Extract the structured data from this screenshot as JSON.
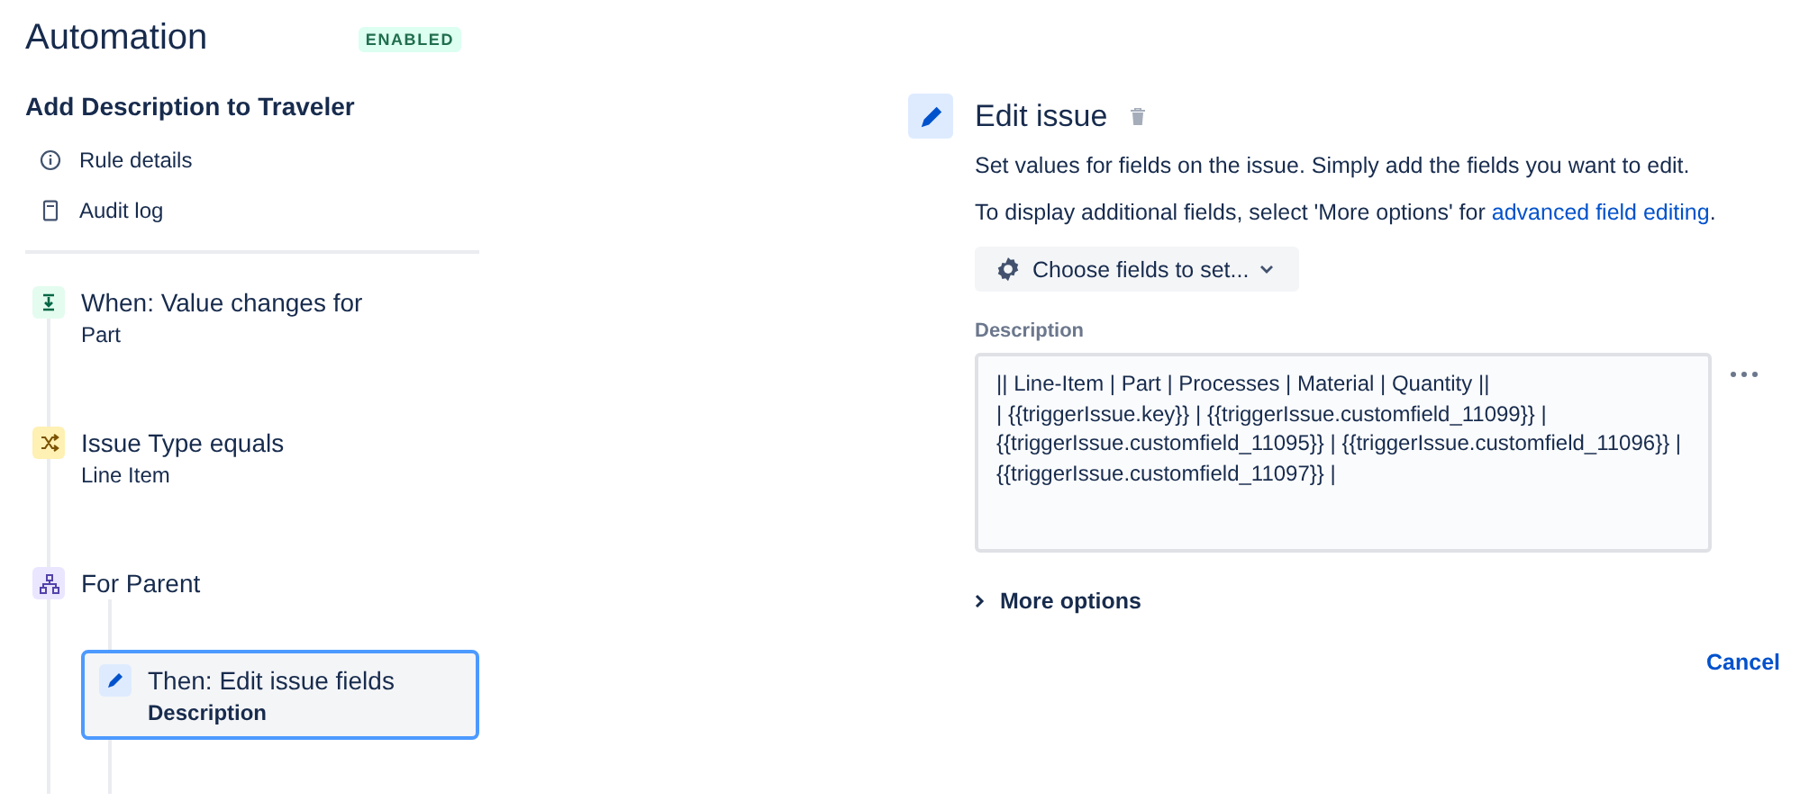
{
  "header": {
    "title": "Automation",
    "status": "ENABLED"
  },
  "rule": {
    "name": "Add Description to Traveler",
    "links": [
      {
        "kind": "info",
        "label": "Rule details"
      },
      {
        "kind": "log",
        "label": "Audit log"
      }
    ],
    "steps": [
      {
        "kind": "trigger",
        "title": "When: Value changes for",
        "subtitle": "Part",
        "selected": false
      },
      {
        "kind": "condition",
        "title": "Issue Type equals",
        "subtitle": "Line Item",
        "selected": false
      },
      {
        "kind": "branch",
        "title": "For Parent",
        "selected": false,
        "children": [
          {
            "kind": "action",
            "title": "Then: Edit issue fields",
            "subtitle": "Description",
            "selected": true
          }
        ]
      }
    ]
  },
  "editor": {
    "title": "Edit issue",
    "intro": "Set values for fields on the issue. Simply add the fields you want to edit.",
    "hint": "To display additional fields, select 'More options' for",
    "hint_link": "advanced field editing",
    "hint_end": ".",
    "choose_button": "Choose fields to set...",
    "field_label": "Description",
    "field_value": "|| Line-Item | Part | Processes | Material | Quantity ||\n| {{triggerIssue.key}} | {{triggerIssue.customfield_11099}} | {{triggerIssue.customfield_11095}} | {{triggerIssue.customfield_11096}} | {{triggerIssue.customfield_11097}} |",
    "more_options": {
      "label": "More options",
      "expanded": false
    },
    "cancel": "Cancel"
  }
}
